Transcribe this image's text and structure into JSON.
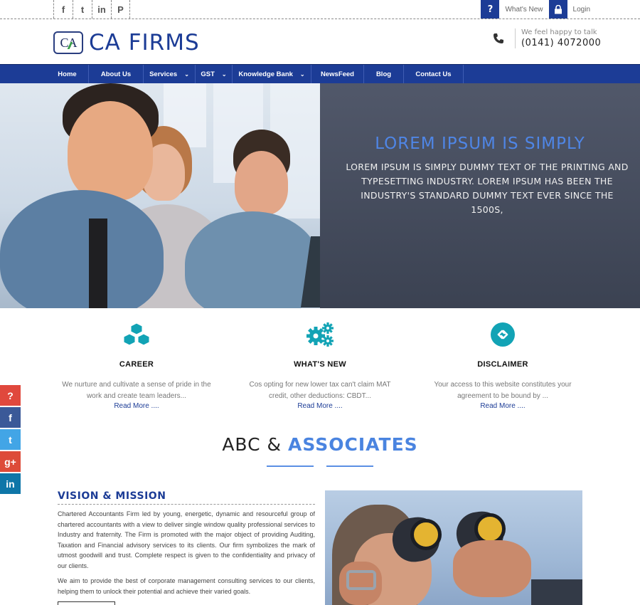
{
  "topbar": {
    "social": [
      "f",
      "t",
      "in",
      "P"
    ],
    "whats_new_label": "What's New",
    "login_label": "Login"
  },
  "header": {
    "brand_mark": "CA",
    "brand_name": "CA FIRMS",
    "contact_tagline": "We feel happy to talk",
    "contact_phone": "(0141) 4072000"
  },
  "nav": {
    "items": [
      {
        "label": "Home",
        "dropdown": false
      },
      {
        "label": "About Us",
        "dropdown": false
      },
      {
        "label": "Services",
        "dropdown": true
      },
      {
        "label": "GST",
        "dropdown": true
      },
      {
        "label": "Knowledge Bank",
        "dropdown": true
      },
      {
        "label": "NewsFeed",
        "dropdown": false
      },
      {
        "label": "Blog",
        "dropdown": false
      },
      {
        "label": "Contact Us",
        "dropdown": false
      }
    ]
  },
  "hero": {
    "title": "LOREM IPSUM IS SIMPLY",
    "text": "LOREM IPSUM IS SIMPLY DUMMY TEXT OF THE PRINTING AND TYPESETTING INDUSTRY. LOREM IPSUM HAS BEEN THE INDUSTRY'S STANDARD DUMMY TEXT EVER SINCE THE 1500S,"
  },
  "features": [
    {
      "icon": "cubes-icon",
      "title": "CAREER",
      "desc": "We nurture and cultivate a sense of pride in the work and create team leaders...",
      "more": "Read More ...."
    },
    {
      "icon": "gears-icon",
      "title": "WHAT'S NEW",
      "desc": "Cos opting for new lower tax can't claim MAT credit, other deductions: CBDT...",
      "more": "Read More ...."
    },
    {
      "icon": "disclaimer-icon",
      "title": "DISCLAIMER",
      "desc": "Your access to this website constitutes your agreement to be bound by ...",
      "more": "Read More ...."
    }
  ],
  "share": [
    "?",
    "f",
    "t",
    "g+",
    "in"
  ],
  "section": {
    "title_a": "ABC &",
    "title_b": "ASSOCIATES"
  },
  "vision": {
    "title": "VISION & MISSION",
    "para1": "Chartered Accountants Firm led by young, energetic, dynamic and resourceful group of chartered accountants with a view to deliver single window quality professional services to Industry and fraternity. The Firm is promoted with the major object of providing Auditing, Taxation and Financial advisory services to its clients. Our firm symbolizes the mark of utmost goodwill and trust. Complete respect is given to the confidentiality and privacy of our clients.",
    "para2": "We aim to provide the best of corporate management consulting services to our clients, helping them to unlock their potential and achieve their varied goals."
  },
  "colors": {
    "brand_blue": "#1c3c96",
    "accent_blue": "#4a84e0",
    "teal": "#12a3b5"
  }
}
